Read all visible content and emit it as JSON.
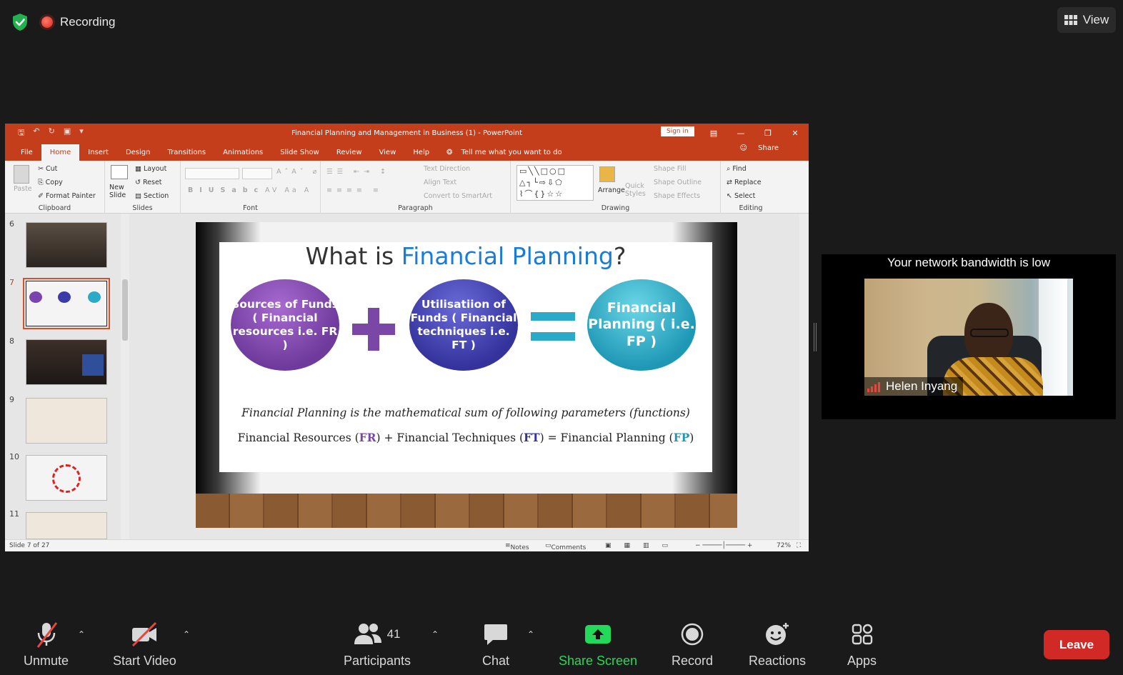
{
  "recording": {
    "label": "Recording"
  },
  "view_button": {
    "label": "View"
  },
  "powerpoint": {
    "title": "Financial Planning and Management in Business (1)  -  PowerPoint",
    "sign_in": "Sign in",
    "tabs": [
      "File",
      "Home",
      "Insert",
      "Design",
      "Transitions",
      "Animations",
      "Slide Show",
      "Review",
      "View",
      "Help"
    ],
    "tell_me": "Tell me what you want to do",
    "share": "Share",
    "ribbon": {
      "clipboard": {
        "label": "Clipboard",
        "paste": "Paste",
        "cut": "Cut",
        "copy": "Copy",
        "format_painter": "Format Painter"
      },
      "slides": {
        "label": "Slides",
        "new_slide": "New Slide",
        "layout": "Layout",
        "reset": "Reset",
        "section": "Section"
      },
      "font": {
        "label": "Font"
      },
      "paragraph": {
        "label": "Paragraph",
        "text_direction": "Text Direction",
        "align_text": "Align Text",
        "convert": "Convert to SmartArt"
      },
      "drawing": {
        "label": "Drawing",
        "arrange": "Arrange",
        "quick_styles": "Quick Styles",
        "shape_fill": "Shape Fill",
        "shape_outline": "Shape Outline",
        "shape_effects": "Shape Effects"
      },
      "editing": {
        "label": "Editing",
        "find": "Find",
        "replace": "Replace",
        "select": "Select"
      }
    },
    "thumbnails": [
      {
        "num": "6"
      },
      {
        "num": "7"
      },
      {
        "num": "8"
      },
      {
        "num": "9"
      },
      {
        "num": "10"
      },
      {
        "num": "11"
      }
    ],
    "slide": {
      "title_a": "What is ",
      "title_b": "Financial Planning",
      "title_c": "?",
      "circle1": "Sources of Funds ( Financial resources i.e. FR )",
      "circle2": "Utilisatiion of Funds ( Financial techniques i.e. FT )",
      "circle3": "Financial Planning ( i.e. FP )",
      "line1": "Financial Planning is the mathematical sum of following parameters (functions)",
      "line2_a": "Financial Resources (",
      "line2_fr": "FR",
      "line2_b": ") + Financial Techniques (",
      "line2_ft": "FT",
      "line2_c": ") = Financial Planning (",
      "line2_fp": "FP",
      "line2_d": ")"
    },
    "status": {
      "slide_counter": "Slide 7 of 27",
      "notes": "Notes",
      "comments": "Comments",
      "zoom": "72%"
    }
  },
  "participant_tile": {
    "banner": "Your network bandwidth is low",
    "name": "Helen Inyang"
  },
  "toolbar": {
    "unmute": "Unmute",
    "start_video": "Start Video",
    "participants": "Participants",
    "participants_count": "41",
    "chat": "Chat",
    "share_screen": "Share Screen",
    "record": "Record",
    "reactions": "Reactions",
    "apps": "Apps",
    "leave": "Leave"
  },
  "colors": {
    "accent_green": "#23d959",
    "leave_red": "#d12a26",
    "ppt_orange": "#c43e1c"
  }
}
